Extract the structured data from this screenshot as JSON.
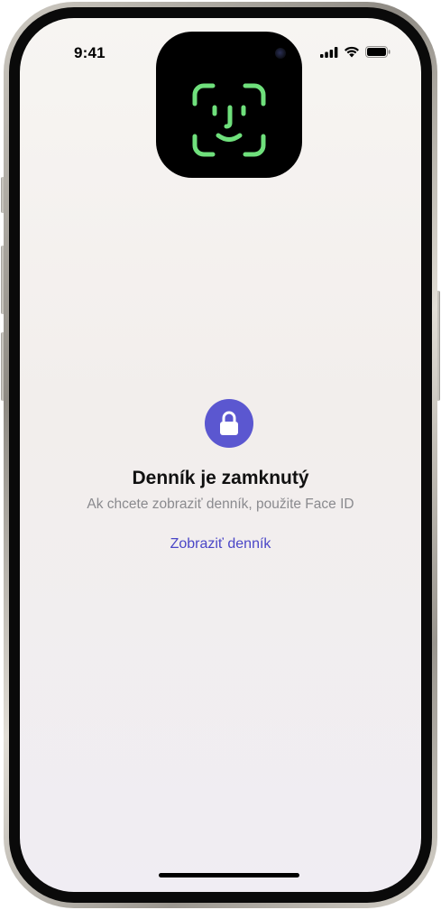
{
  "status_bar": {
    "time": "9:41"
  },
  "island": {
    "icon": "face-id-icon",
    "accent": "#6fe07c"
  },
  "locked_view": {
    "icon": "lock-icon",
    "badge_color": "#5b57d0",
    "title": "Denník je zamknutý",
    "subtitle": "Ak chcete zobraziť denník, použite Face ID",
    "action_label": "Zobraziť denník",
    "action_color": "#4a46c7"
  }
}
